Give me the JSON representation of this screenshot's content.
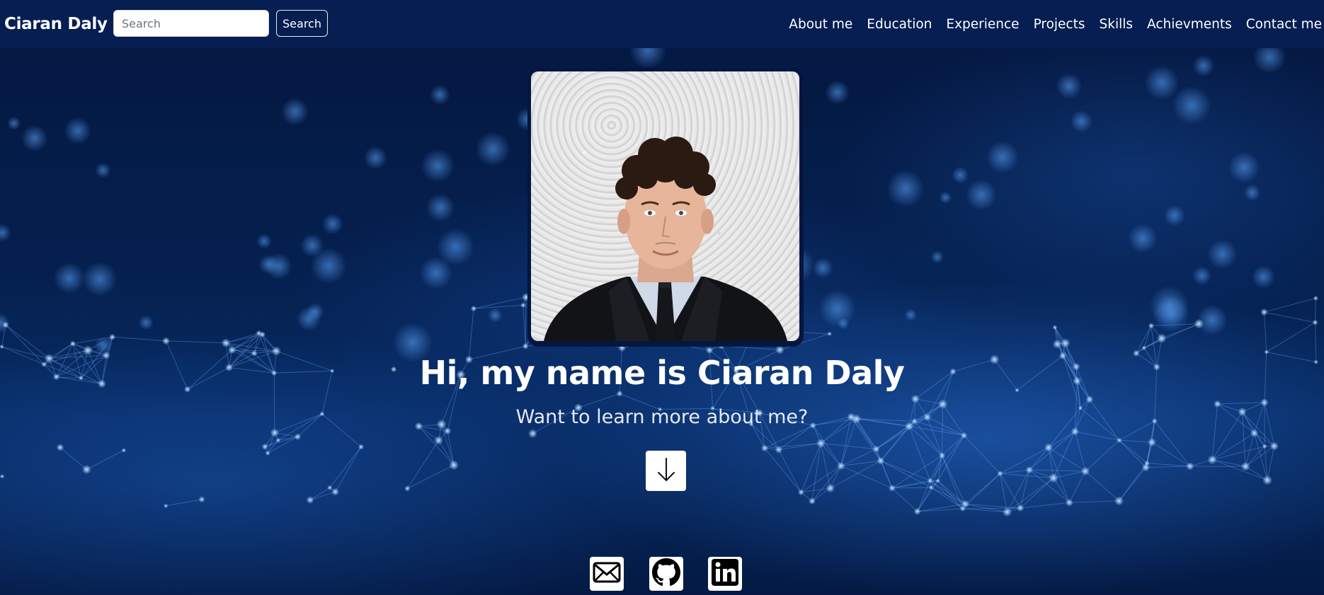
{
  "navbar": {
    "brand": "Ciaran Daly",
    "search_placeholder": "Search",
    "search_button": "Search",
    "links": [
      "About me",
      "Education",
      "Experience",
      "Projects",
      "Skills",
      "Achievments",
      "Contact me"
    ]
  },
  "hero": {
    "headline": "Hi, my name is Ciaran Daly",
    "subheadline": "Want to learn more about me?",
    "scroll_button_icon": "arrow-down-icon"
  },
  "social": [
    "email-icon",
    "github-icon",
    "linkedin-icon"
  ],
  "colors": {
    "navbar_bg": "#061e52",
    "hero_bg": "#03173f",
    "accent": "#2b6fd1"
  }
}
